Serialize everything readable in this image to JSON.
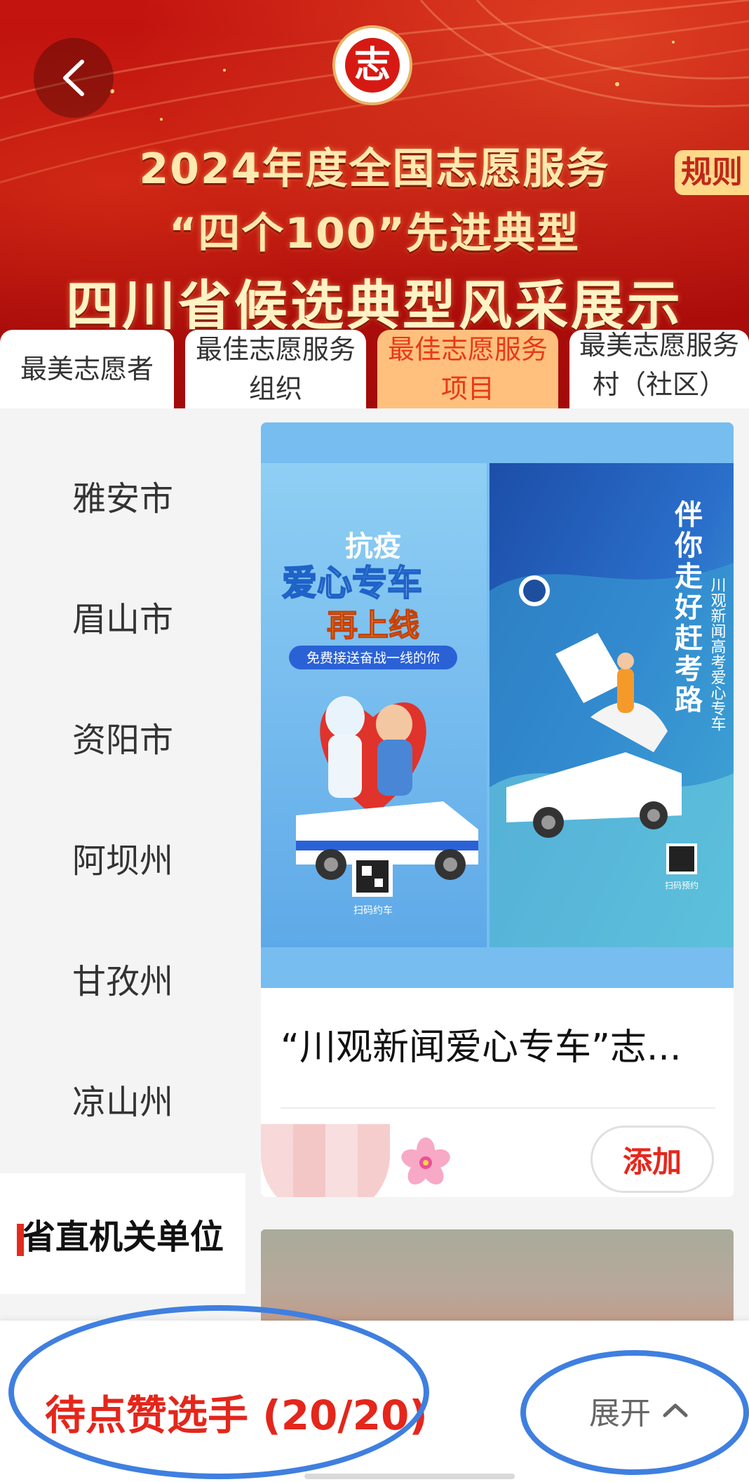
{
  "banner": {
    "title_line1": "2024年度全国志愿服务",
    "title_line2": "“四个100”先进典型",
    "title_line3": "四川省候选典型风采展示",
    "logo_char": "志",
    "rules_label": "规则",
    "accent_color": "#c4140f"
  },
  "tabs": [
    {
      "label": "最美志愿者"
    },
    {
      "label": "最佳志愿服务组织"
    },
    {
      "label": "最佳志愿服务项目",
      "active": true
    },
    {
      "label": "最美志愿服务村（社区）"
    }
  ],
  "sidebar": {
    "items": [
      {
        "label": "雅安市"
      },
      {
        "label": "眉山市"
      },
      {
        "label": "资阳市"
      },
      {
        "label": "阿坝州"
      },
      {
        "label": "甘孜州"
      },
      {
        "label": "凉山州"
      },
      {
        "label": "省直机关单位",
        "active": true
      }
    ]
  },
  "card": {
    "title": "“川观新闻爱心专车”志...",
    "add_label": "添加",
    "poster_left": {
      "line1": "抗疫",
      "line2": "爱心专车",
      "line3": "再上线",
      "sub": "免费接送奋战一线的你",
      "qr_caption": "扫码约车"
    },
    "poster_right": {
      "headline": "伴你走好赶考路",
      "side_text": "川观新闻高考爱心专车",
      "qr_caption": "扫码预约"
    }
  },
  "bottom": {
    "pending_label": "待点赞选手 (20/20)",
    "expand_label": "展开"
  }
}
